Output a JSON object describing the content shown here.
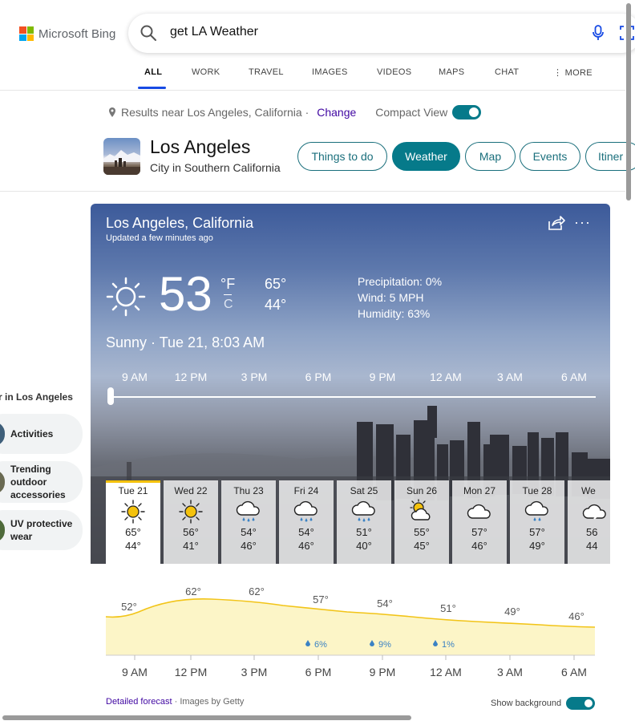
{
  "header": {
    "logo_text": "Microsoft Bing",
    "logo_colors": [
      "#f25022",
      "#7fba00",
      "#00a4ef",
      "#ffb900"
    ],
    "search_query": "get LA Weather"
  },
  "nav": {
    "tabs": [
      {
        "label": "ALL",
        "active": true
      },
      {
        "label": "WORK"
      },
      {
        "label": "TRAVEL"
      },
      {
        "label": "IMAGES"
      },
      {
        "label": "VIDEOS"
      },
      {
        "label": "MAPS"
      },
      {
        "label": "CHAT"
      },
      {
        "label": "⋮ MORE"
      }
    ]
  },
  "location_bar": {
    "text": "Results near Los Angeles, California ·",
    "change_label": "Change",
    "compact_label": "Compact View"
  },
  "entity": {
    "title": "Los Angeles",
    "subtitle": "City in Southern California",
    "pills": [
      "Things to do",
      "Weather",
      "Map",
      "Events",
      "Itiner"
    ]
  },
  "sidebar": {
    "title": "r in Los Angeles",
    "items": [
      {
        "label": "Activities"
      },
      {
        "label": "Trending outdoor accessories"
      },
      {
        "label": "UV protective wear"
      }
    ]
  },
  "weather": {
    "location": "Los Angeles, California",
    "updated": "Updated a few minutes ago",
    "temp": "53",
    "unit_f": "°F",
    "unit_c": "C",
    "hi": "65°",
    "lo": "44°",
    "precipitation": "Precipitation: 0%",
    "wind": "Wind: 5 MPH",
    "humidity": "Humidity: 63%",
    "condition": "Sunny · Tue 21, 8:03 AM",
    "hours": [
      "9 AM",
      "12 PM",
      "3 PM",
      "6 PM",
      "9 PM",
      "12 AM",
      "3 AM",
      "6 AM"
    ],
    "days": [
      {
        "name": "Tue 21",
        "hi": "65°",
        "lo": "44°",
        "icon": "sun-icon"
      },
      {
        "name": "Wed 22",
        "hi": "56°",
        "lo": "41°",
        "icon": "sun-icon"
      },
      {
        "name": "Thu 23",
        "hi": "54°",
        "lo": "46°",
        "icon": "rain-cloud-icon"
      },
      {
        "name": "Fri 24",
        "hi": "54°",
        "lo": "46°",
        "icon": "rain-cloud-icon"
      },
      {
        "name": "Sat 25",
        "hi": "51°",
        "lo": "40°",
        "icon": "rain-cloud-icon"
      },
      {
        "name": "Sun 26",
        "hi": "55°",
        "lo": "45°",
        "icon": "partly-sunny-icon"
      },
      {
        "name": "Mon 27",
        "hi": "57°",
        "lo": "46°",
        "icon": "cloud-icon"
      },
      {
        "name": "Tue 28",
        "hi": "57°",
        "lo": "49°",
        "icon": "rain-cloud-icon"
      },
      {
        "name": "We",
        "hi": "56",
        "lo": "44",
        "icon": "cloud-icon"
      }
    ]
  },
  "hourly": {
    "temps": [
      "52°",
      "62°",
      "62°",
      "57°",
      "54°",
      "51°",
      "49°",
      "46°"
    ],
    "precip": [
      "6%",
      "9%",
      "1%"
    ],
    "hours": [
      "9 AM",
      "12 PM",
      "3 PM",
      "6 PM",
      "9 PM",
      "12 AM",
      "3 AM",
      "6 AM"
    ],
    "detailed_link": "Detailed forecast",
    "images_by": " · Images by Getty",
    "show_background": "Show background"
  }
}
